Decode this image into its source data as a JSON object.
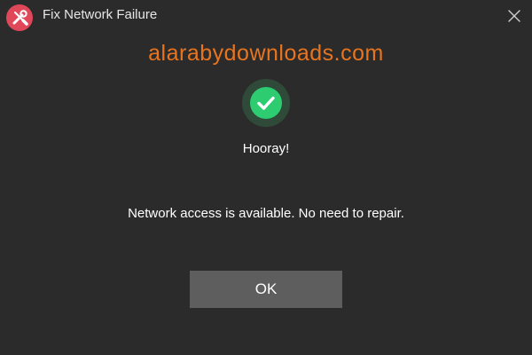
{
  "window": {
    "title": "Fix Network Failure",
    "app_icon": "tools-icon",
    "close_icon": "close-icon"
  },
  "watermark": {
    "text": "alarabydownloads.com",
    "color": "#e8741e"
  },
  "result": {
    "status_icon": "check-circle-icon",
    "status_color": "#2ecc71",
    "headline": "Hooray!",
    "message": "Network access is available. No need to repair."
  },
  "actions": {
    "ok_label": "OK"
  },
  "colors": {
    "background": "#2b2b2b",
    "button": "#5e5e5e",
    "app_icon_bg": "#e0485a"
  }
}
